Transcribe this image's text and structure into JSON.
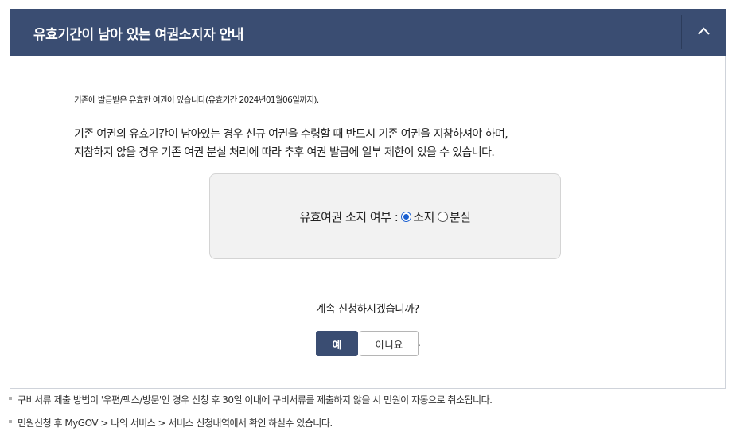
{
  "header": {
    "title": "유효기간이 남아 있는 여권소지자 안내"
  },
  "notice": {
    "valid_passport": "기존에 발급받은 유효한 여권이 있습니다(유효기간 2024년01월06일까지).",
    "warning_line1": "기존 여권의 유효기간이 남아있는 경우 신규 여권을 수령할 때 반드시 기존 여권을 지참하셔야 하며,",
    "warning_line2": "지참하지 않을 경우 기존 여권 분실 처리에 따라 추후 여권 발급에 일부 제한이 있을 수 있습니다."
  },
  "possession": {
    "label": "유효여권 소지 여부 :",
    "options": [
      {
        "label": "소지",
        "checked": true
      },
      {
        "label": "분실",
        "checked": false
      }
    ]
  },
  "confirm": {
    "question": "계속 신청하시겠습니까?",
    "yes_label": "예",
    "no_label": "아니요",
    "trailing": "."
  },
  "footnotes": [
    "구비서류 제출 방법이 '우편/팩스/방문'인 경우 신청 후 30일 이내에 구비서류를 제출하지 않을 시 민원이 자동으로 취소됩니다.",
    "민원신청 후 MyGOV > 나의 서비스 > 서비스 신청내역에서 확인 하실수 있습니다."
  ],
  "colors": {
    "header_bg": "#3a4d72",
    "primary_button": "#3a4d72",
    "radio_selected": "#1a5fd0"
  },
  "icons": {
    "collapse": "chevron-up-icon",
    "footnote_bullet": "square-bullet-icon"
  }
}
